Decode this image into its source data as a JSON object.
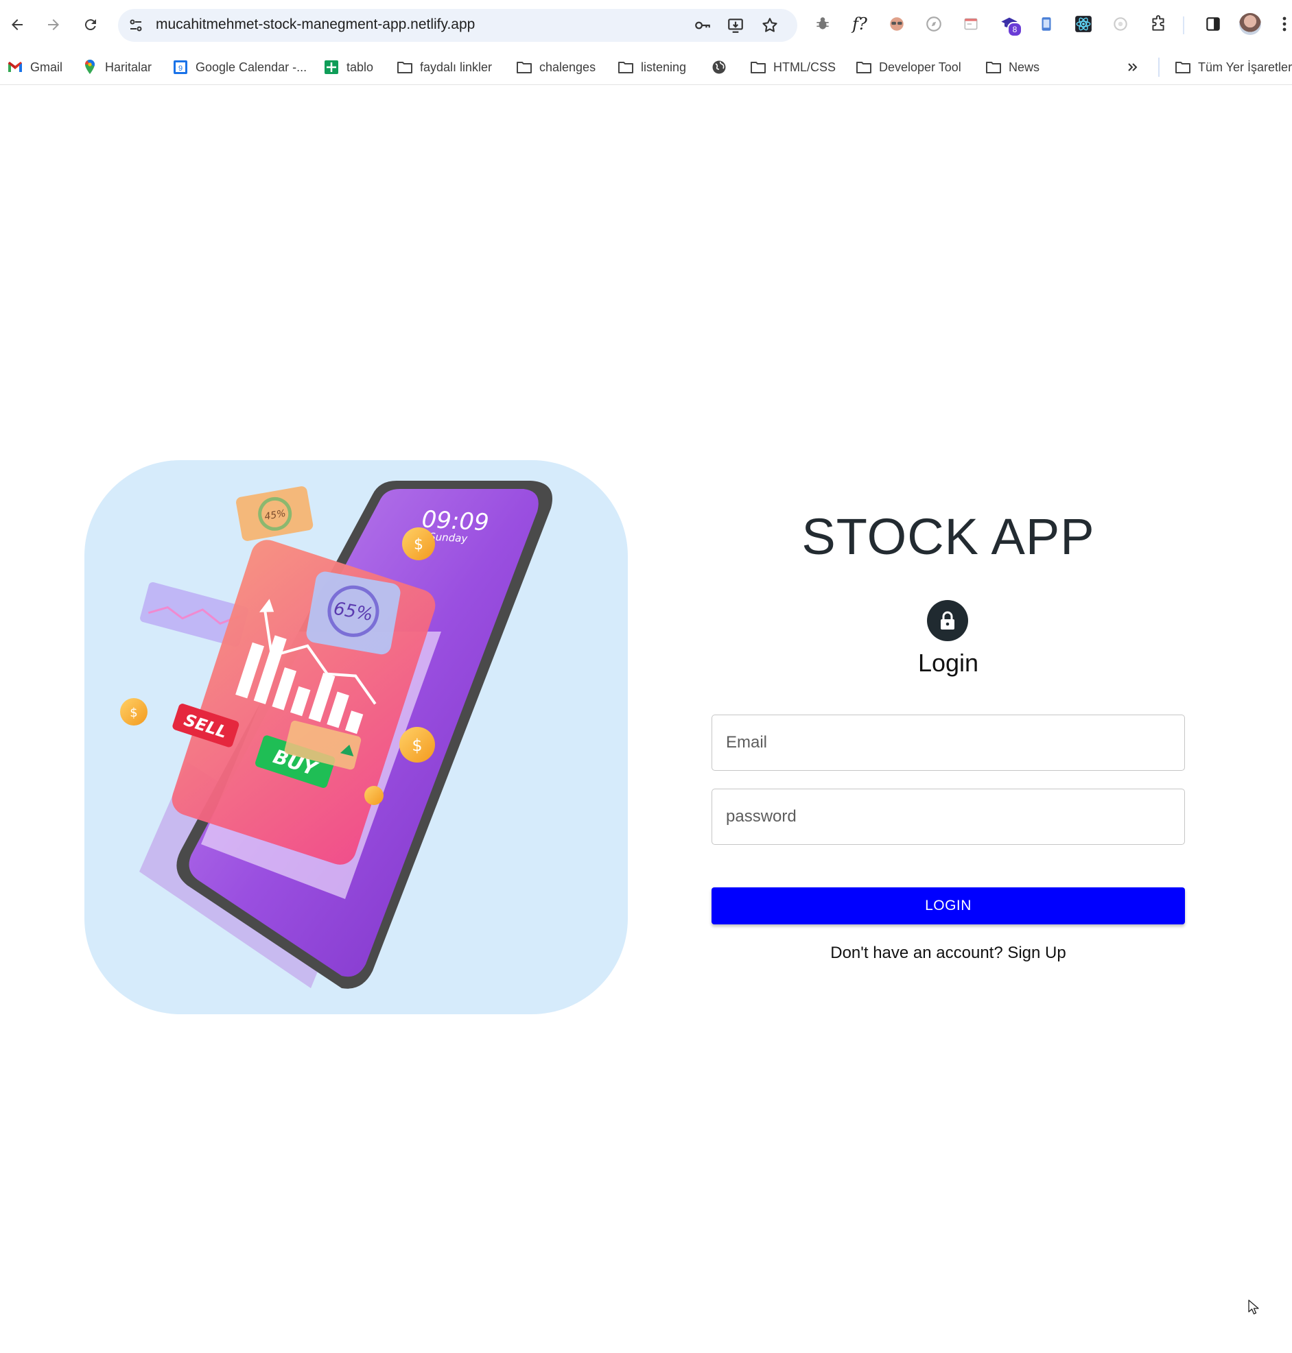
{
  "browser": {
    "url": "mucahitmehmet-stock-manegment-app.netlify.app",
    "extension_badge": "8",
    "bookmarks": [
      {
        "label": "Gmail",
        "icon": "gmail-icon"
      },
      {
        "label": "Haritalar",
        "icon": "maps-icon"
      },
      {
        "label": "Google Calendar -...",
        "icon": "calendar-icon"
      },
      {
        "label": "tablo",
        "icon": "sheets-icon"
      },
      {
        "label": "faydalı linkler",
        "icon": "folder-icon"
      },
      {
        "label": "chalenges",
        "icon": "folder-icon"
      },
      {
        "label": "listening",
        "icon": "folder-icon"
      },
      {
        "label": "",
        "icon": "globe-icon"
      },
      {
        "label": "HTML/CSS",
        "icon": "folder-icon"
      },
      {
        "label": "Developer Tool",
        "icon": "folder-icon"
      },
      {
        "label": "News",
        "icon": "folder-icon"
      }
    ],
    "all_bookmarks": "Tüm Yer İşaretleri"
  },
  "illustration": {
    "clock_time": "09:09",
    "clock_day": "Sunday",
    "badge_percent_small": "45%",
    "badge_percent_large": "65%",
    "sell_label": "SELL",
    "buy_label": "BUY"
  },
  "login": {
    "app_title": "STOCK APP",
    "heading": "Login",
    "email_placeholder": "Email",
    "password_placeholder": "password",
    "button_label": "LOGIN",
    "signup_prompt": "Don't have an account? Sign Up"
  },
  "colors": {
    "primary_button": "#0000ff",
    "hero_background": "#d6ebfb",
    "lock_circle": "#202a30"
  }
}
